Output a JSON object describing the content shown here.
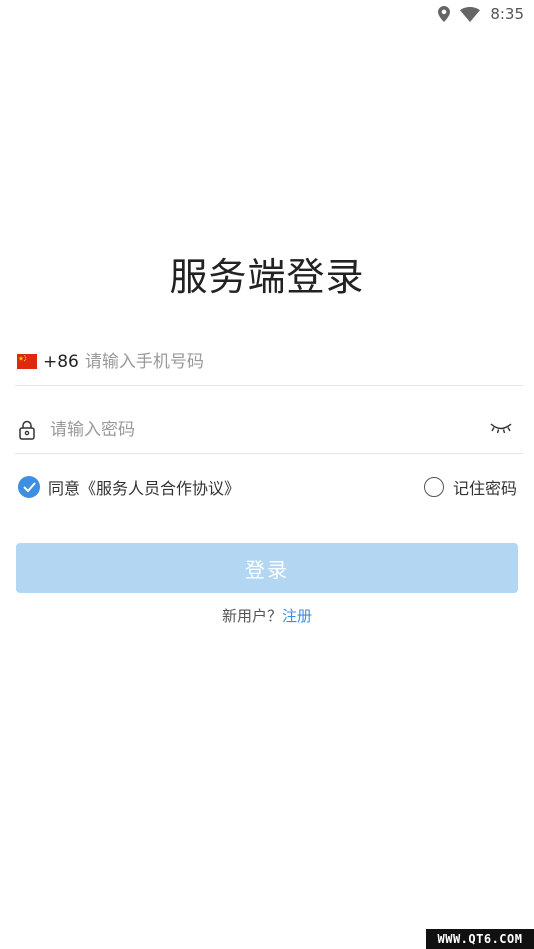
{
  "status_bar": {
    "time": "8:35",
    "icons": [
      "location-icon",
      "wifi-icon"
    ]
  },
  "login": {
    "title": "服务端登录",
    "phone": {
      "country_code": "+86",
      "flag": "cn-flag-icon",
      "placeholder": "请输入手机号码",
      "value": ""
    },
    "password": {
      "placeholder": "请输入密码",
      "value": ""
    },
    "agreement": {
      "checked": true,
      "label": "同意《服务人员合作协议》"
    },
    "remember": {
      "checked": false,
      "label": "记住密码"
    },
    "submit_label": "登录",
    "register": {
      "prompt": "新用户？",
      "link": "注册"
    }
  },
  "watermark": "WWW.QT6.COM",
  "colors": {
    "accent": "#3d8fe0",
    "button_disabled": "#b3d6f3",
    "text": "#222222",
    "placeholder": "#9a9a9a"
  }
}
